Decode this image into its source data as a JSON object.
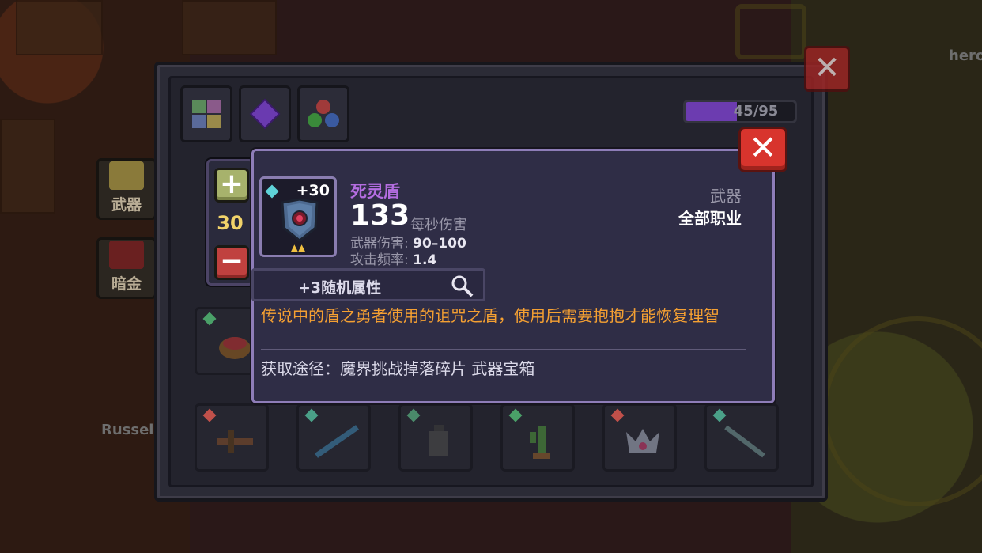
{
  "background": {
    "npc_name": "Russel",
    "corner_text": "hero"
  },
  "side_tabs": [
    {
      "label": "武器",
      "icon": "weapon-icon"
    },
    {
      "label": "暗金",
      "icon": "dark-gold-icon"
    }
  ],
  "inventory": {
    "filters": [
      {
        "icon": "all-items-grid-icon"
      },
      {
        "icon": "purple-gem-icon"
      },
      {
        "icon": "material-orbs-icon"
      }
    ],
    "capacity": {
      "text": "45/95",
      "used": 45,
      "total": 95
    },
    "bottom_row": [
      {
        "icon": "crossbow-icon",
        "gem_color": "#c0504a"
      },
      {
        "icon": "rifle-icon",
        "gem_color": "#4aa088"
      },
      {
        "icon": "lantern-icon",
        "gem_color": "#4a8a6a"
      },
      {
        "icon": "cactus-icon",
        "gem_color": "#4aa068"
      },
      {
        "icon": "crown-icon",
        "gem_color": "#c0504a"
      },
      {
        "icon": "blade-icon",
        "gem_color": "#4aa088"
      }
    ],
    "left_slot": {
      "icon": "basket-icon",
      "gem_color": "#4aa068"
    }
  },
  "stepper": {
    "plus": "+",
    "minus": "−",
    "quantity": "30"
  },
  "item": {
    "level": "+30",
    "name": "死灵盾",
    "dps": "133",
    "dps_label": "每秒伤害",
    "damage_label": "武器伤害:",
    "damage_value": "90–100",
    "rate_label": "攻击频率:",
    "rate_value": "1.4",
    "type": "武器",
    "class": "全部职业",
    "random_attr": "+3随机属性",
    "description": "传说中的盾之勇者使用的诅咒之盾，使用后需要抱抱才能恢复理智",
    "source": "获取途径：魔界挑战掉落碎片 武器宝箱",
    "colors": {
      "name": "#b46de0",
      "description": "#f5a032",
      "rarity": "#5fd3d8"
    }
  },
  "close_glyph": "✕"
}
